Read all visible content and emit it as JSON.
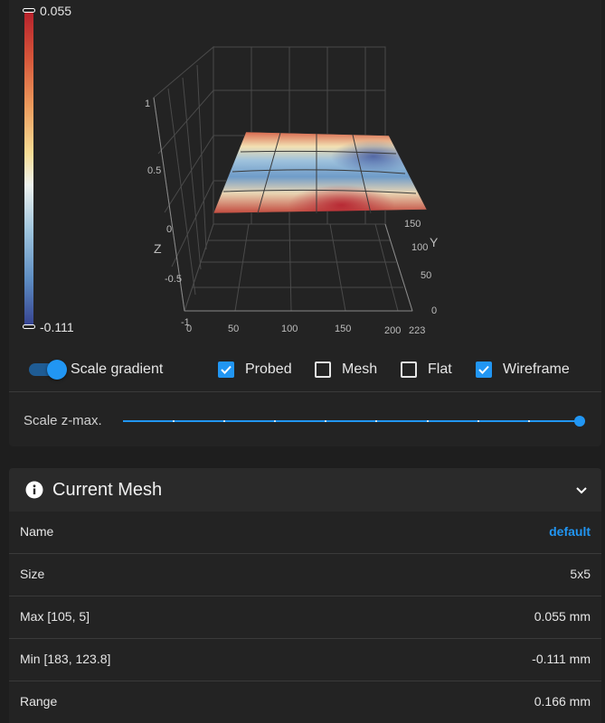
{
  "colorbar": {
    "max_label": "0.055",
    "min_label": "-0.111"
  },
  "plot": {
    "z_ticks": [
      "1",
      "0.5",
      "0",
      "-0.5",
      "-1"
    ],
    "x_ticks": [
      "0",
      "50",
      "100",
      "150",
      "200",
      "223"
    ],
    "y_ticks": [
      "0",
      "50",
      "100",
      "150"
    ],
    "z_title": "Z",
    "y_title": "Y"
  },
  "controls": {
    "scale_gradient": {
      "label": "Scale gradient",
      "checked": true
    },
    "probed": {
      "label": "Probed",
      "checked": true
    },
    "mesh": {
      "label": "Mesh",
      "checked": false
    },
    "flat": {
      "label": "Flat",
      "checked": false
    },
    "wireframe": {
      "label": "Wireframe",
      "checked": true
    }
  },
  "slider": {
    "label": "Scale z-max.",
    "value_fraction": 1.0
  },
  "mesh_panel": {
    "title": "Current Mesh",
    "rows": [
      {
        "key": "Name",
        "value": "default"
      },
      {
        "key": "Size",
        "value": "5x5"
      },
      {
        "key": "Max [105, 5]",
        "value": "0.055 mm"
      },
      {
        "key": "Min [183, 123.8]",
        "value": "-0.111 mm"
      },
      {
        "key": "Range",
        "value": "0.166 mm"
      }
    ]
  },
  "colors": {
    "accent": "#2196f3",
    "card": "#232323",
    "background": "#1e1e1e"
  }
}
